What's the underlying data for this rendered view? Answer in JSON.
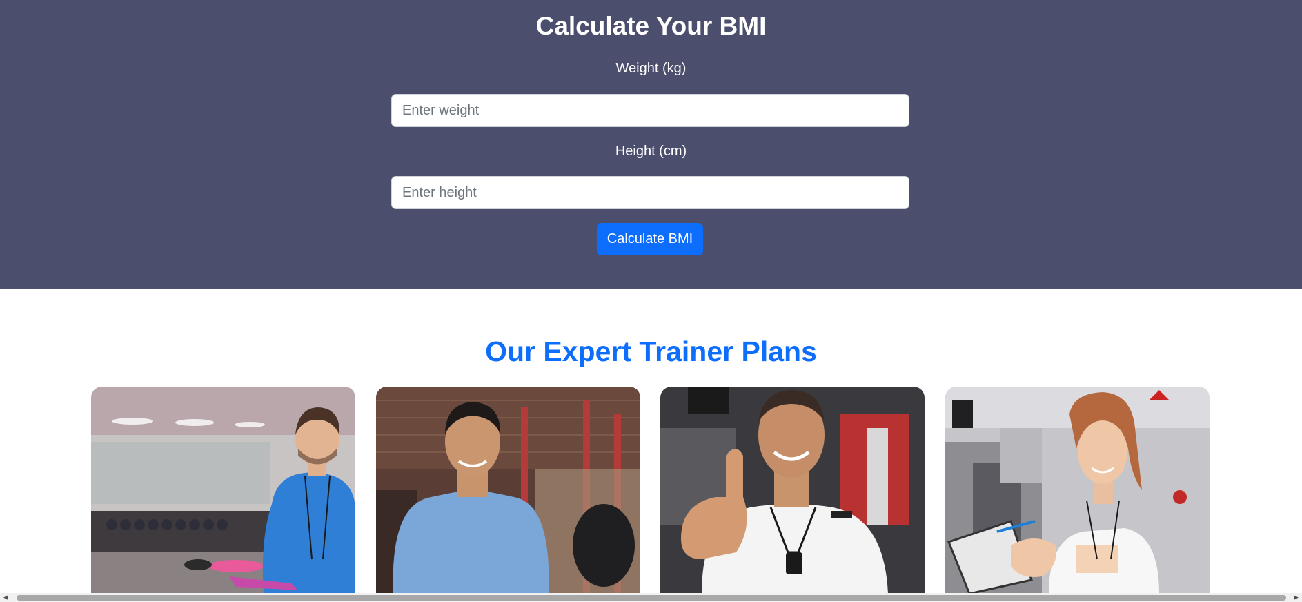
{
  "colors": {
    "bmi_background": "#4b4f6d",
    "accent": "#0d6efd",
    "button": "#0d6efd"
  },
  "bmi": {
    "title": "Calculate Your BMI",
    "weight": {
      "label": "Weight (kg)",
      "placeholder": "Enter weight",
      "value": ""
    },
    "height": {
      "label": "Height (cm)",
      "placeholder": "Enter height",
      "value": ""
    },
    "button_label": "Calculate BMI"
  },
  "trainers": {
    "title": "Our Expert Trainer Plans",
    "cards": [
      {
        "image": "trainer-photo-male-gym-tablet"
      },
      {
        "image": "trainer-photo-male-blue-shirt"
      },
      {
        "image": "trainer-photo-male-thumbs-up-whistle"
      },
      {
        "image": "trainer-photo-female-clipboard"
      }
    ]
  },
  "scrollbar": {
    "left_icon": "chevron-left-icon",
    "right_icon": "chevron-right-icon"
  }
}
